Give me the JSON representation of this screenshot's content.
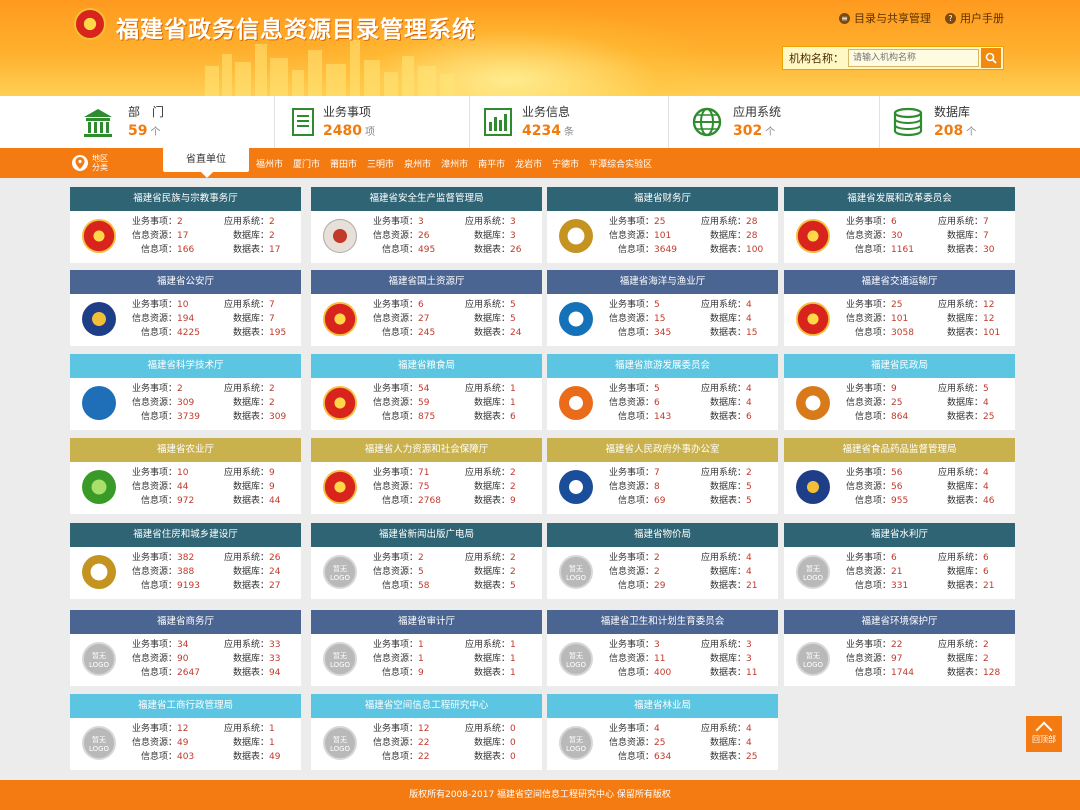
{
  "header": {
    "title": "福建省政务信息资源目录管理系统",
    "links": [
      {
        "label": "目录与共享管理",
        "icon": "catalog-icon"
      },
      {
        "label": "用户手册",
        "icon": "help-icon"
      }
    ],
    "search": {
      "label": "机构名称：",
      "placeholder": "请输入机构名称"
    }
  },
  "stats": [
    {
      "name": "部　门",
      "value": "59",
      "unit": "个",
      "icon": "building-icon"
    },
    {
      "name": "业务事项",
      "value": "2480",
      "unit": "项",
      "icon": "document-icon"
    },
    {
      "name": "业务信息",
      "value": "4234",
      "unit": "条",
      "icon": "chart-doc-icon"
    },
    {
      "name": "应用系统",
      "value": "302",
      "unit": "个",
      "icon": "globe-icon"
    },
    {
      "name": "数据库",
      "value": "208",
      "unit": "个",
      "icon": "database-icon"
    }
  ],
  "nav": {
    "region_label_1": "地区",
    "region_label_2": "分类",
    "active_tab": "省直单位",
    "cities": [
      "福州市",
      "厦门市",
      "莆田市",
      "三明市",
      "泉州市",
      "漳州市",
      "南平市",
      "龙岩市",
      "宁德市",
      "平潭综合实验区"
    ]
  },
  "labels": {
    "biz": "业务事项：",
    "res": "信息资源：",
    "items": "信息项：",
    "apps": "应用系统：",
    "db": "数据库：",
    "tables": "数据表："
  },
  "no_logo": {
    "line1": "暂无",
    "line2": "LOGO"
  },
  "cards": [
    {
      "title": "福建省民族与宗教事务厅",
      "theme": "teal",
      "logo": "emblem",
      "biz": "2",
      "res": "17",
      "items": "166",
      "apps": "2",
      "db": "2",
      "tables": "17"
    },
    {
      "title": "福建省安全生产监督管理局",
      "theme": "teal",
      "logo": "seal",
      "biz": "3",
      "res": "26",
      "items": "495",
      "apps": "3",
      "db": "3",
      "tables": "26"
    },
    {
      "title": "福建省财务厅",
      "theme": "teal",
      "logo": "gold",
      "biz": "25",
      "res": "101",
      "items": "3649",
      "apps": "28",
      "db": "28",
      "tables": "100"
    },
    {
      "title": "福建省发展和改革委员会",
      "theme": "teal",
      "logo": "emblem",
      "biz": "6",
      "res": "30",
      "items": "1161",
      "apps": "7",
      "db": "7",
      "tables": "30"
    },
    {
      "title": "福建省公安厅",
      "theme": "navy",
      "logo": "police",
      "biz": "10",
      "res": "194",
      "items": "4225",
      "apps": "7",
      "db": "7",
      "tables": "195"
    },
    {
      "title": "福建省国土资源厅",
      "theme": "navy",
      "logo": "emblem",
      "biz": "6",
      "res": "27",
      "items": "245",
      "apps": "5",
      "db": "5",
      "tables": "24"
    },
    {
      "title": "福建省海洋与渔业厅",
      "theme": "navy",
      "logo": "blue",
      "biz": "5",
      "res": "15",
      "items": "345",
      "apps": "4",
      "db": "4",
      "tables": "15"
    },
    {
      "title": "福建省交通运输厅",
      "theme": "navy",
      "logo": "emblem",
      "biz": "25",
      "res": "101",
      "items": "3058",
      "apps": "12",
      "db": "12",
      "tables": "101"
    },
    {
      "title": "福建省科学技术厅",
      "theme": "sky",
      "logo": "sci",
      "biz": "2",
      "res": "309",
      "items": "3739",
      "apps": "2",
      "db": "2",
      "tables": "309"
    },
    {
      "title": "福建省粮食局",
      "theme": "sky",
      "logo": "emblem",
      "biz": "54",
      "res": "59",
      "items": "875",
      "apps": "1",
      "db": "1",
      "tables": "6"
    },
    {
      "title": "福建省旅游发展委员会",
      "theme": "sky",
      "logo": "orange",
      "biz": "5",
      "res": "6",
      "items": "143",
      "apps": "4",
      "db": "4",
      "tables": "6"
    },
    {
      "title": "福建省民政局",
      "theme": "sky",
      "logo": "culture",
      "biz": "9",
      "res": "25",
      "items": "864",
      "apps": "5",
      "db": "4",
      "tables": "25"
    },
    {
      "title": "福建省农业厅",
      "theme": "gold",
      "logo": "green",
      "biz": "10",
      "res": "44",
      "items": "972",
      "apps": "9",
      "db": "9",
      "tables": "44"
    },
    {
      "title": "福建省人力资源和社会保障厅",
      "theme": "gold",
      "logo": "emblem",
      "biz": "71",
      "res": "75",
      "items": "2768",
      "apps": "2",
      "db": "2",
      "tables": "9"
    },
    {
      "title": "福建省人民政府外事办公室",
      "theme": "gold",
      "logo": "navy",
      "biz": "7",
      "res": "8",
      "items": "69",
      "apps": "2",
      "db": "5",
      "tables": "5"
    },
    {
      "title": "福建省食品药品监督管理局",
      "theme": "gold",
      "logo": "food",
      "biz": "56",
      "res": "56",
      "items": "955",
      "apps": "4",
      "db": "4",
      "tables": "46"
    },
    {
      "title": "福建省住房和城乡建设厅",
      "theme": "teal",
      "logo": "gold",
      "biz": "382",
      "res": "388",
      "items": "9193",
      "apps": "26",
      "db": "24",
      "tables": "27"
    },
    {
      "title": "福建省新闻出版广电局",
      "theme": "teal",
      "logo": "nologo",
      "biz": "2",
      "res": "5",
      "items": "58",
      "apps": "2",
      "db": "2",
      "tables": "5"
    },
    {
      "title": "福建省物价局",
      "theme": "teal",
      "logo": "nologo",
      "biz": "2",
      "res": "2",
      "items": "29",
      "apps": "4",
      "db": "4",
      "tables": "21"
    },
    {
      "title": "福建省水利厅",
      "theme": "teal",
      "logo": "nologo",
      "biz": "6",
      "res": "21",
      "items": "331",
      "apps": "6",
      "db": "6",
      "tables": "21"
    },
    {
      "title": "福建省商务厅",
      "theme": "navy",
      "logo": "nologo",
      "biz": "34",
      "res": "90",
      "items": "2647",
      "apps": "33",
      "db": "33",
      "tables": "94"
    },
    {
      "title": "福建省审计厅",
      "theme": "navy",
      "logo": "nologo",
      "biz": "1",
      "res": "1",
      "items": "9",
      "apps": "1",
      "db": "1",
      "tables": "1"
    },
    {
      "title": "福建省卫生和计划生育委员会",
      "theme": "navy",
      "logo": "nologo",
      "biz": "3",
      "res": "11",
      "items": "400",
      "apps": "3",
      "db": "3",
      "tables": "11"
    },
    {
      "title": "福建省环境保护厅",
      "theme": "navy",
      "logo": "nologo",
      "biz": "22",
      "res": "97",
      "items": "1744",
      "apps": "2",
      "db": "2",
      "tables": "128"
    },
    {
      "title": "福建省工商行政管理局",
      "theme": "sky",
      "logo": "nologo",
      "biz": "12",
      "res": "49",
      "items": "403",
      "apps": "1",
      "db": "1",
      "tables": "49"
    },
    {
      "title": "福建省空间信息工程研究中心",
      "theme": "sky",
      "logo": "nologo",
      "biz": "12",
      "res": "22",
      "items": "22",
      "apps": "0",
      "db": "0",
      "tables": "0"
    },
    {
      "title": "福建省林业局",
      "theme": "sky",
      "logo": "nologo",
      "biz": "4",
      "res": "25",
      "items": "634",
      "apps": "4",
      "db": "4",
      "tables": "25"
    }
  ],
  "back_to_top": "回顶部",
  "footer": "版权所有2008-2017   福建省空间信息工程研究中心 保留所有版权",
  "colors": {
    "accent": "#f47b12",
    "value_red": "#c0392b",
    "teal": "#2f6475",
    "navy": "#4b6592",
    "sky": "#5cc6e2",
    "gold": "#c9b24e"
  }
}
